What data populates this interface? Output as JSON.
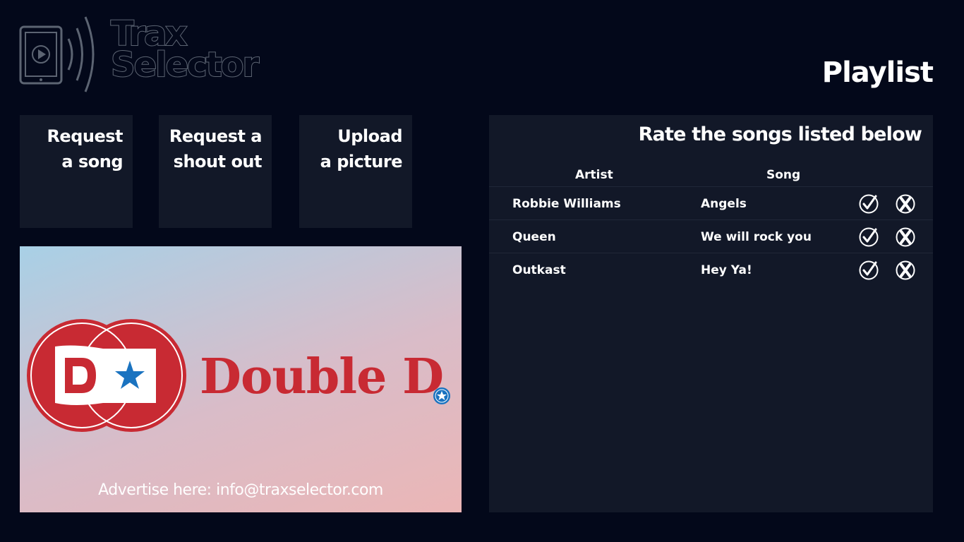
{
  "logo": {
    "line1": "Trax",
    "line2": "Selector"
  },
  "page_title": "Playlist",
  "tiles": [
    {
      "line1": "Request",
      "line2": "a song"
    },
    {
      "line1": "Request a",
      "line2": "shout out"
    },
    {
      "line1": "Upload",
      "line2": "a picture"
    }
  ],
  "ad": {
    "brand": "Double D",
    "contact": "Advertise here: info@traxselector.com"
  },
  "playlist": {
    "heading": "Rate the songs listed below",
    "columns": {
      "artist": "Artist",
      "song": "Song"
    },
    "rows": [
      {
        "artist": "Robbie Williams",
        "song": "Angels"
      },
      {
        "artist": "Queen",
        "song": "We will rock you"
      },
      {
        "artist": "Outkast",
        "song": "Hey Ya!"
      }
    ]
  },
  "colors": {
    "background": "#03081a",
    "panel": "#121828",
    "brand_red": "#c82a33",
    "brand_blue": "#1a73c0"
  },
  "icons": {
    "like": "check-circle-icon",
    "dislike": "x-circle-icon"
  }
}
